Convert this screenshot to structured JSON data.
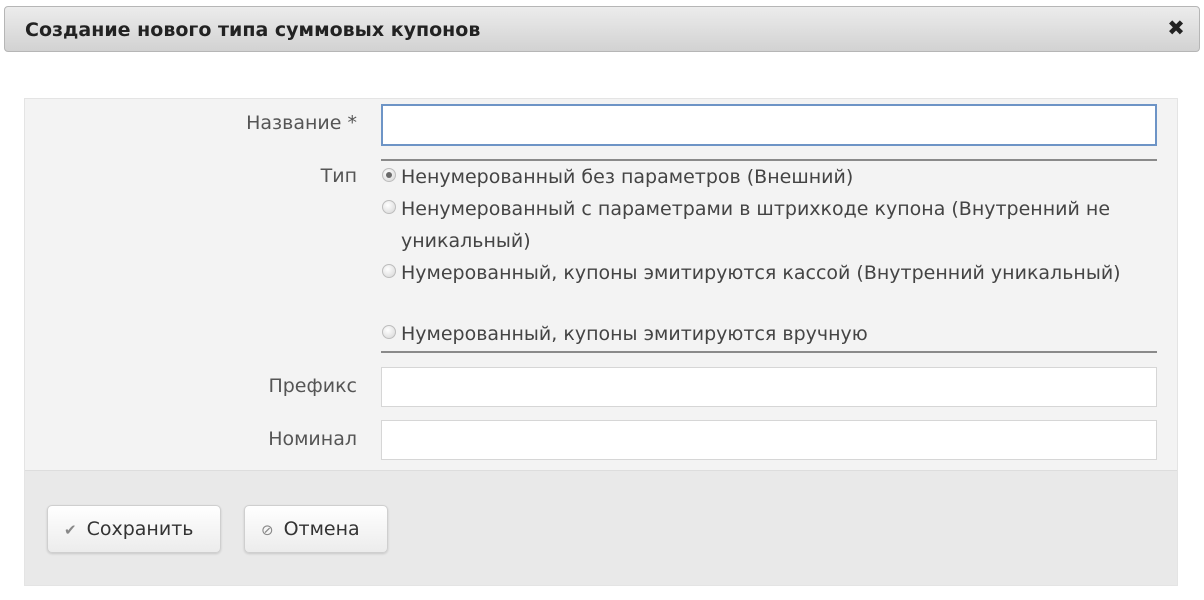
{
  "dialog": {
    "title": "Создание нового типа суммовых купонов",
    "close_icon": "close-icon",
    "close_glyph": "✖"
  },
  "form": {
    "name_label": "Название *",
    "name_value": "",
    "type_label": "Тип",
    "type_options": [
      {
        "label": "Ненумерованный без параметров (Внешний)",
        "checked": true
      },
      {
        "label": "Ненумерованный с параметрами в штрихкоде купона (Внутренний не уникальный)",
        "checked": false
      },
      {
        "label": "Нумерованный, купоны эмитируются кассой (Внутренний уникальный)",
        "checked": false
      },
      {
        "label": "Нумерованный, купоны эмитируются вручную",
        "checked": false
      }
    ],
    "prefix_label": "Префикс",
    "prefix_value": "",
    "nominal_label": "Номинал",
    "nominal_value": ""
  },
  "buttons": {
    "save_label": "Сохранить",
    "save_icon": "checkmark-icon",
    "save_glyph": "✔",
    "cancel_label": "Отмена",
    "cancel_icon": "cancel-icon",
    "cancel_glyph": "⊘"
  }
}
